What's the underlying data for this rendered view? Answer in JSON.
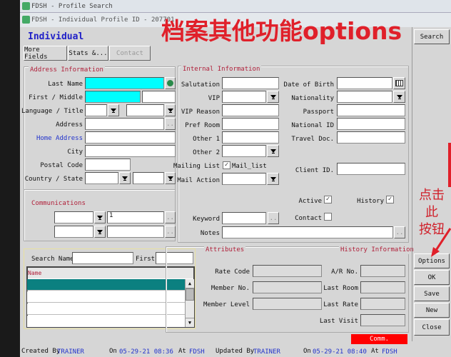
{
  "windows": {
    "outer_title": "FDSH - Profile Search",
    "inner_title": "FDSH - Individual Profile ID - 207701"
  },
  "header": {
    "type": "Individual"
  },
  "tabs": [
    "More Fields",
    "Stats &...",
    "Contact"
  ],
  "annotations": {
    "heading": "档案其他功能options",
    "callout": [
      "点击",
      "此",
      "按钮"
    ]
  },
  "address": {
    "title": "Address Information",
    "last_name": "Last Name",
    "first_middle": "First / Middle",
    "language_title": "Language / Title",
    "address": "Address",
    "home_address": "Home Address",
    "city": "City",
    "postal_code": "Postal Code",
    "country_state": "Country / State",
    "ellipsis": ".."
  },
  "communications": {
    "title": "Communications",
    "value1": "1"
  },
  "internal": {
    "title": "Internal Information",
    "salutation": "Salutation",
    "vip": "VIP",
    "vip_reason": "VIP Reason",
    "pref_room": "Pref Room",
    "other1": "Other 1",
    "other2": "Other 2",
    "mailing_list": "Mailing List",
    "mail_list_value": "Mail_list",
    "mail_action": "Mail Action",
    "date_of_birth": "Date of Birth",
    "nationality": "Nationality",
    "passport": "Passport",
    "national_id": "National ID",
    "travel_doc": "Travel Doc.",
    "client_id": "Client ID.",
    "active": "Active",
    "history": "History",
    "contact": "Contact",
    "keyword": "Keyword",
    "notes": "Notes",
    "active_checked": true,
    "history_checked": true,
    "contact_checked": false,
    "mailing_checked": true
  },
  "search": {
    "search_name": "Search Name",
    "first": "First",
    "column": "Name"
  },
  "attributes": {
    "title": "Attributes",
    "history_title": "History Information",
    "rate_code": "Rate Code",
    "member_no": "Member No.",
    "member_level": "Member Level",
    "ar_no": "A/R No.",
    "last_room": "Last Room",
    "last_rate": "Last Rate",
    "last_visit": "Last Visit",
    "comm": "Comm."
  },
  "buttons": {
    "search": "Search",
    "options": "Options",
    "ok": "OK",
    "save": "Save",
    "new": "New",
    "close": "Close"
  },
  "footer": {
    "created_by": "Created By",
    "created_user": "TRAINER",
    "on1": "On",
    "created_date": "05-29-21 08:36",
    "at1": "At",
    "created_at": "FDSH",
    "updated_by": "Updated By",
    "updated_user": "TRAINER",
    "on2": "On",
    "updated_date": "05-29-21 08:40",
    "at2": "At",
    "updated_at": "FDSH"
  }
}
